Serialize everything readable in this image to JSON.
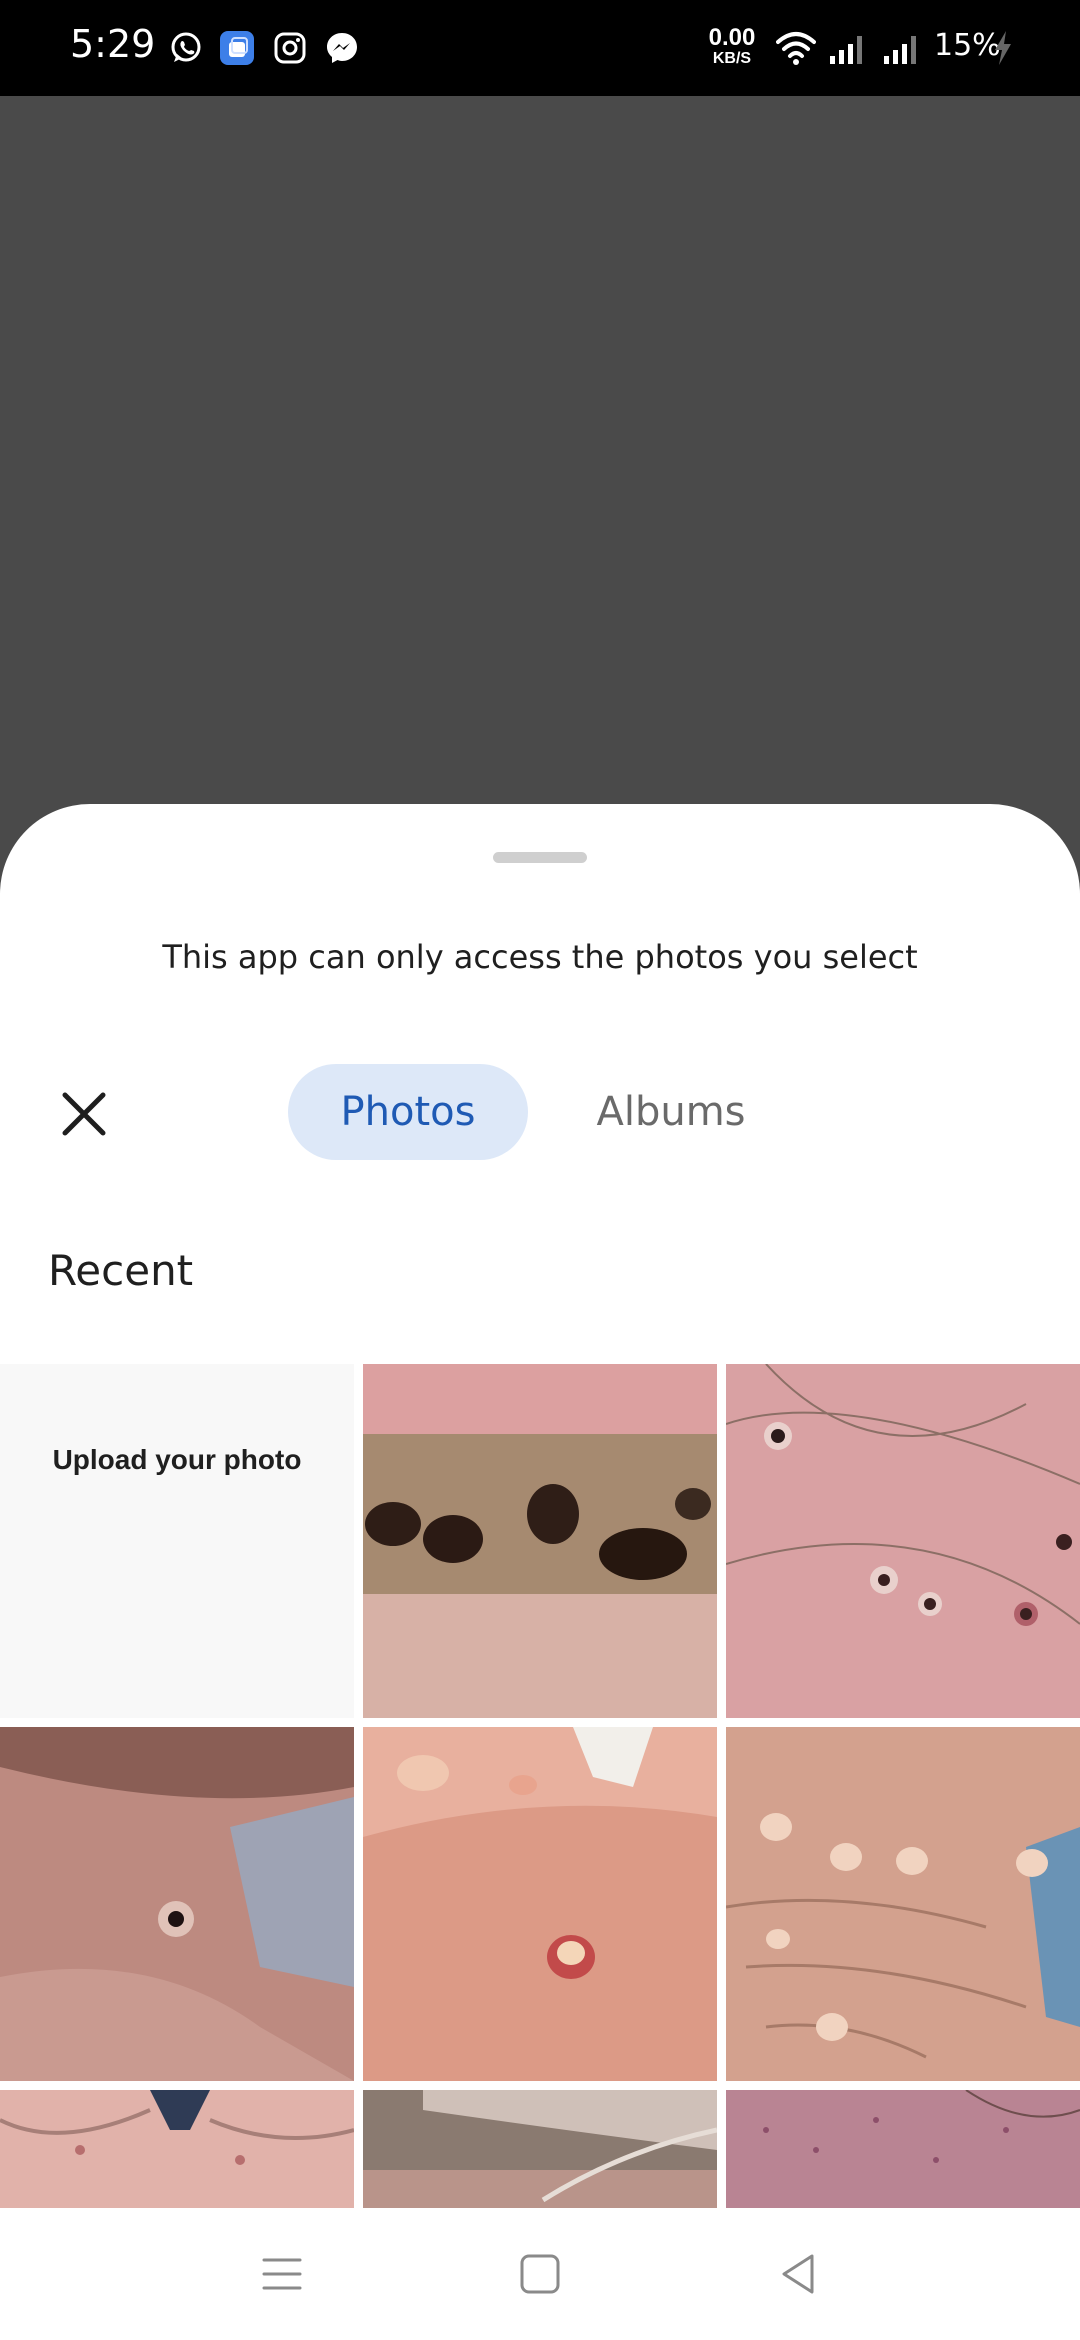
{
  "status_bar": {
    "time": "5:29",
    "notifications": [
      "whatsapp-icon",
      "multi-window-icon",
      "instagram-icon",
      "messenger-icon"
    ],
    "net_speed_value": "0.00",
    "net_speed_unit": "KB/S",
    "battery": "15%"
  },
  "sheet": {
    "info_text": "This app can only access the photos you select",
    "tabs": [
      {
        "label": "Photos",
        "selected": true
      },
      {
        "label": "Albums",
        "selected": false
      }
    ],
    "section_title": "Recent",
    "upload_label": "Upload your photo"
  },
  "colors": {
    "accent": "#1f5ab4",
    "tab_selected_bg": "#dde8f8",
    "scrim": "#4a4a4a"
  }
}
